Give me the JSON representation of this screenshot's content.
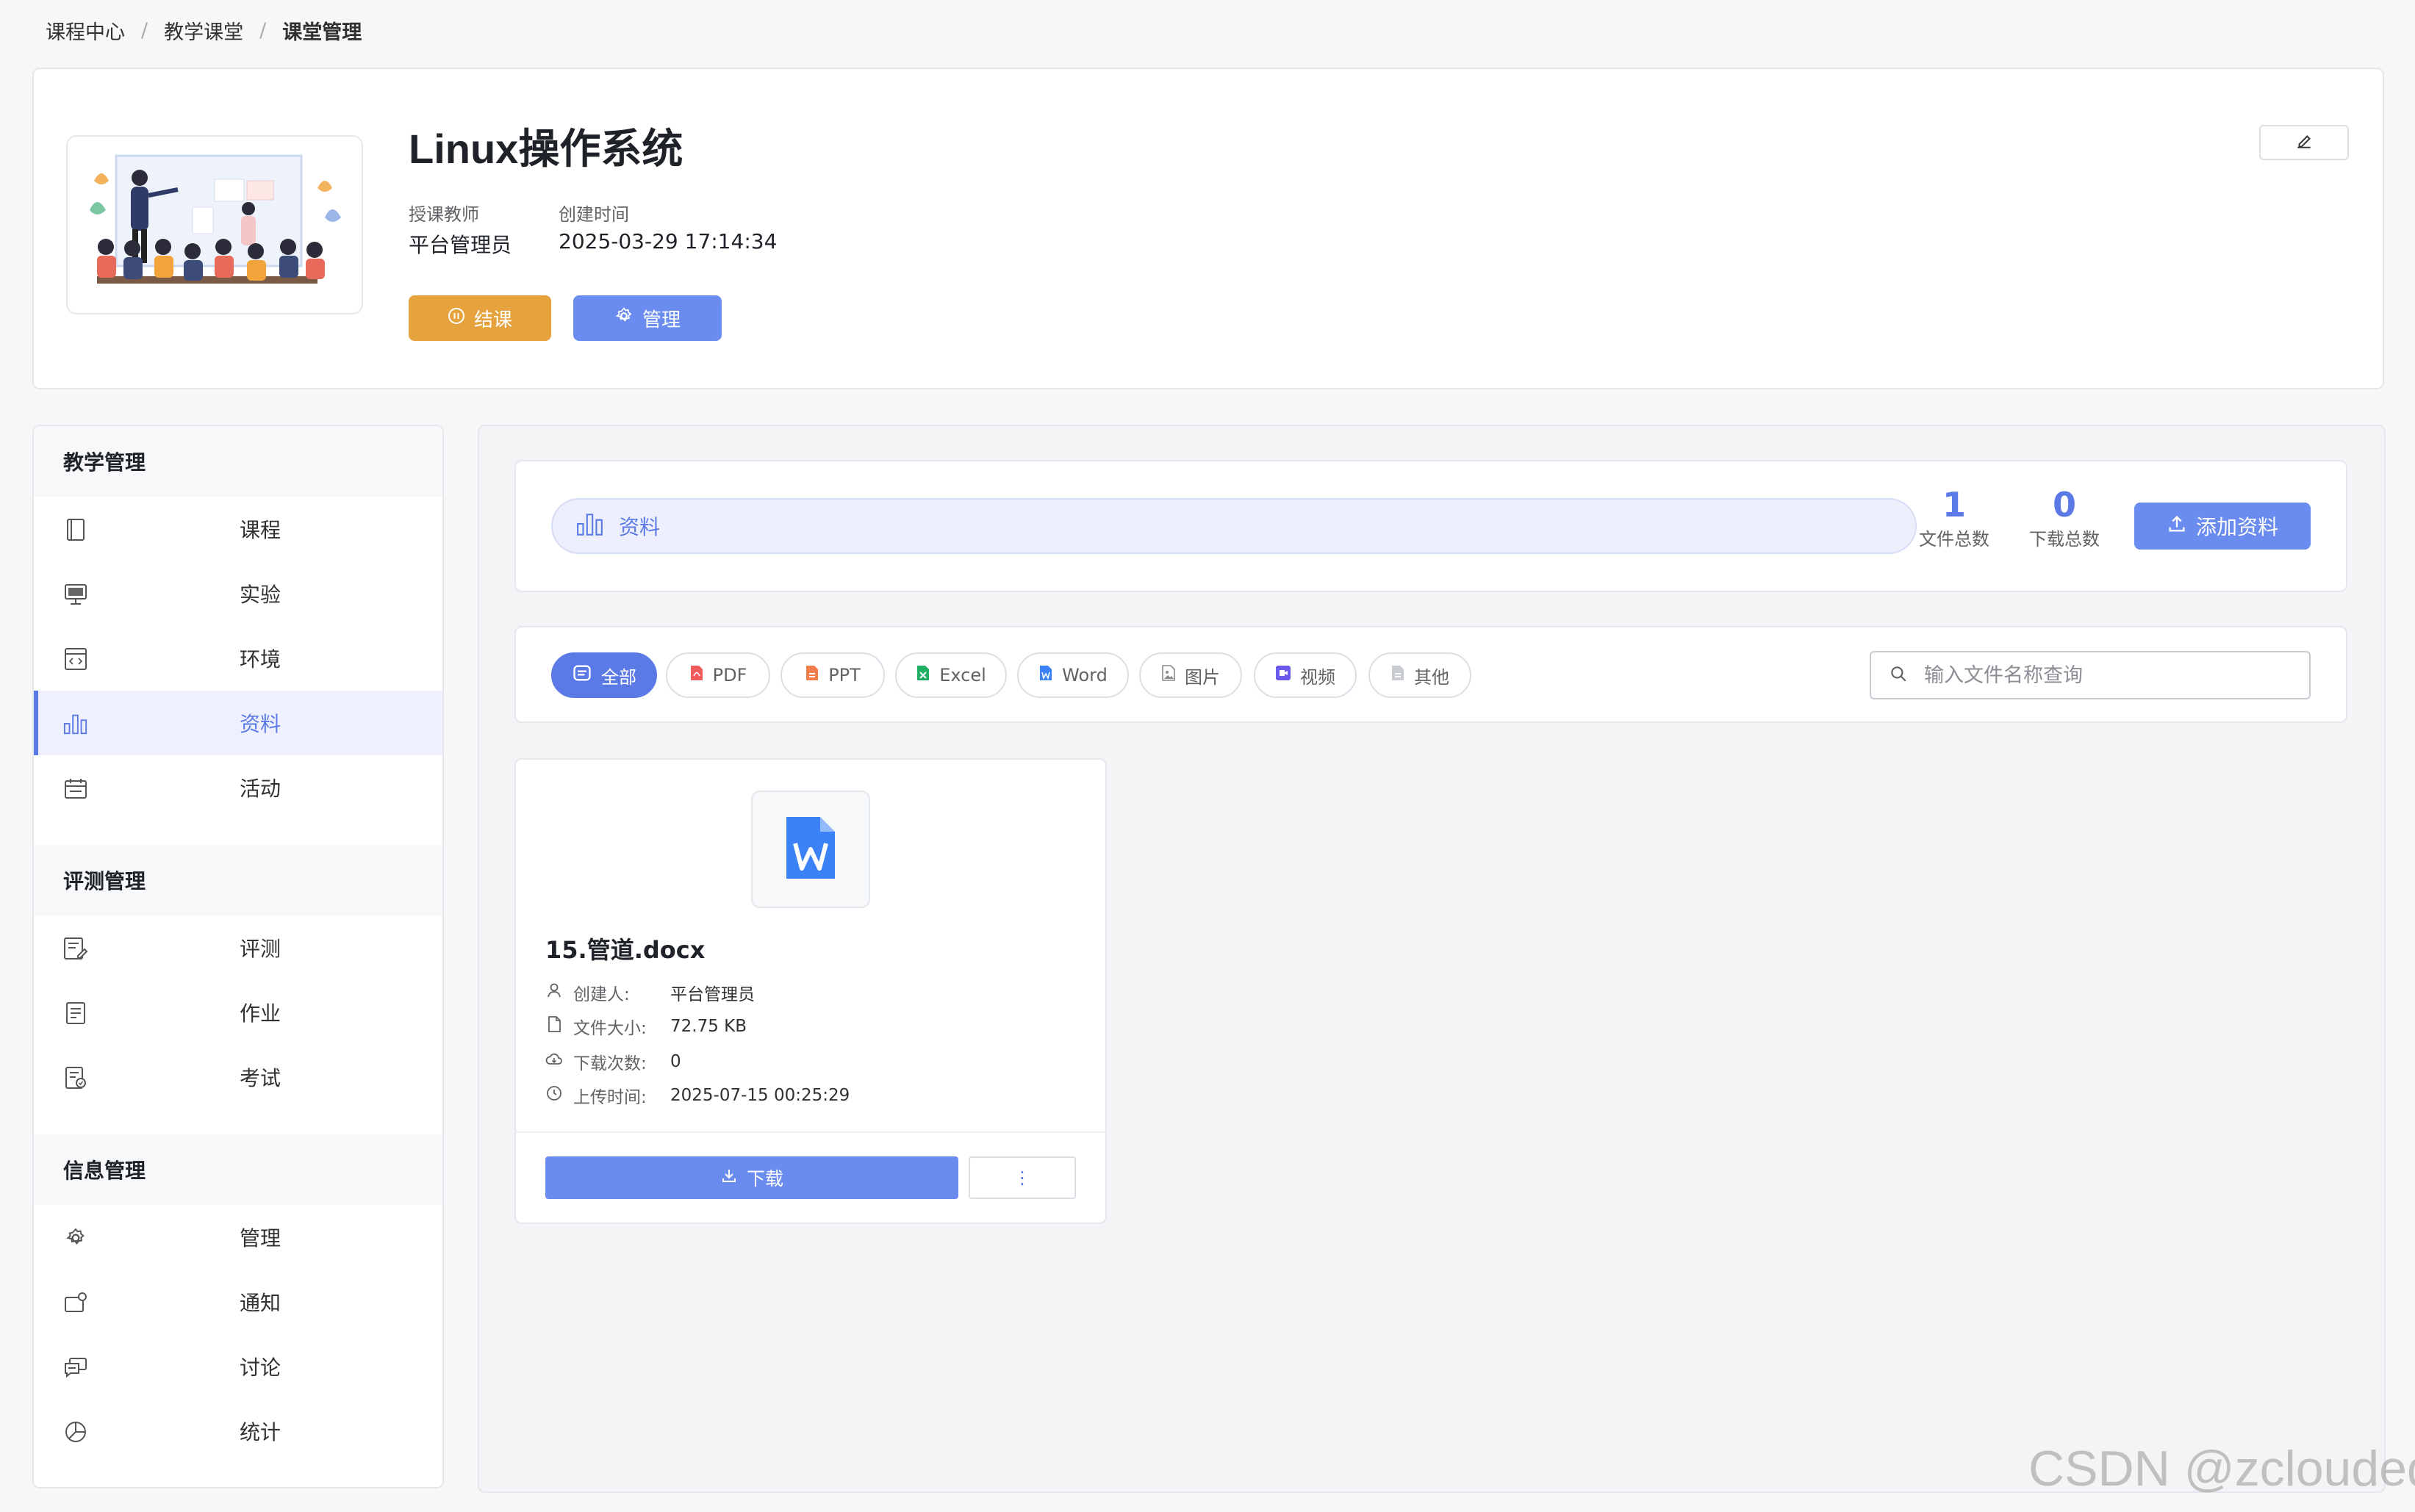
{
  "breadcrumb": {
    "items": [
      "课程中心",
      "教学课堂"
    ],
    "current": "课堂管理",
    "separator": "/"
  },
  "course": {
    "title": "Linux操作系统",
    "teacher_label": "授课教师",
    "teacher": "平台管理员",
    "created_label": "创建时间",
    "created": "2025-03-29 17:14:34",
    "end_button": "结课",
    "manage_button": "管理"
  },
  "sidebar": {
    "groups": [
      {
        "title": "教学管理",
        "items": [
          {
            "label": "课程",
            "icon": "book-icon"
          },
          {
            "label": "实验",
            "icon": "monitor-icon"
          },
          {
            "label": "环境",
            "icon": "code-window-icon"
          },
          {
            "label": "资料",
            "icon": "bar-chart-icon",
            "active": true
          },
          {
            "label": "活动",
            "icon": "calendar-icon"
          }
        ]
      },
      {
        "title": "评测管理",
        "items": [
          {
            "label": "评测",
            "icon": "edit-doc-icon"
          },
          {
            "label": "作业",
            "icon": "document-icon"
          },
          {
            "label": "考试",
            "icon": "exam-icon"
          }
        ]
      },
      {
        "title": "信息管理",
        "items": [
          {
            "label": "管理",
            "icon": "gear-icon"
          },
          {
            "label": "通知",
            "icon": "notification-icon"
          },
          {
            "label": "讨论",
            "icon": "chat-icon"
          },
          {
            "label": "统计",
            "icon": "pie-chart-icon"
          }
        ]
      }
    ]
  },
  "stats": {
    "section_label": "资料",
    "file_total": "1",
    "file_total_label": "文件总数",
    "download_total": "0",
    "download_total_label": "下载总数",
    "add_button": "添加资料"
  },
  "filters": {
    "chips": [
      {
        "label": "全部",
        "icon": "list-icon",
        "active": true
      },
      {
        "label": "PDF",
        "icon": "pdf-icon"
      },
      {
        "label": "PPT",
        "icon": "ppt-icon"
      },
      {
        "label": "Excel",
        "icon": "excel-icon"
      },
      {
        "label": "Word",
        "icon": "word-icon"
      },
      {
        "label": "图片",
        "icon": "image-icon"
      },
      {
        "label": "视频",
        "icon": "video-icon"
      },
      {
        "label": "其他",
        "icon": "file-icon"
      }
    ],
    "search_placeholder": "输入文件名称查询",
    "search_value": ""
  },
  "files": [
    {
      "name": "15.管道.docx",
      "icon": "word-doc-icon",
      "creator_label": "创建人:",
      "creator": "平台管理员",
      "size_label": "文件大小:",
      "size": "72.75 KB",
      "downloads_label": "下载次数:",
      "downloads": "0",
      "uploaded_label": "上传时间:",
      "uploaded": "2025-07-15 00:25:29",
      "download_button": "下载",
      "more_button": "⋮"
    }
  ],
  "watermark": "CSDN @zcloudedu",
  "colors": {
    "primary": "#5b7ae6",
    "warning": "#e6a23c",
    "word": "#3b82f6"
  }
}
